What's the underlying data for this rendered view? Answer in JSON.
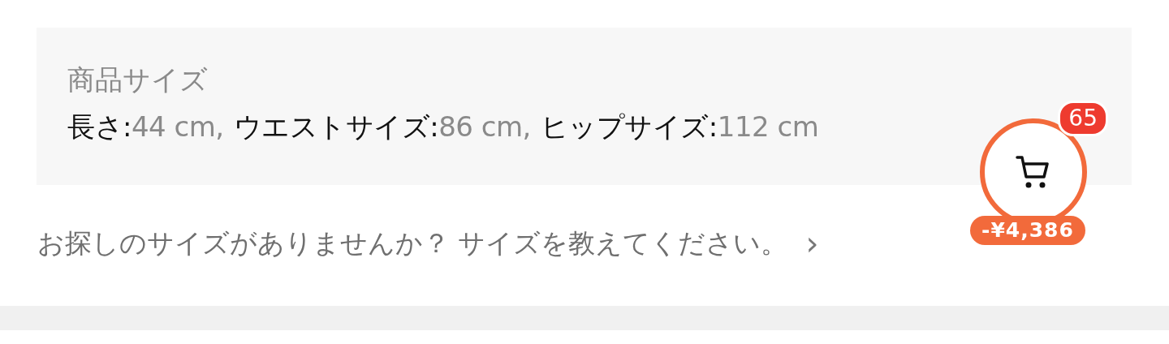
{
  "size_panel": {
    "title": "商品サイズ",
    "measurements": [
      {
        "label": "長さ:",
        "value": "44 cm,"
      },
      {
        "label": "ウエストサイズ:",
        "value": "86 cm,"
      },
      {
        "label": "ヒップサイズ:",
        "value": "112 cm"
      }
    ]
  },
  "size_request_link": {
    "text": "お探しのサイズがありませんか？ サイズを教えてください。",
    "chevron": "›"
  },
  "cart": {
    "count": "65",
    "discount": "-¥4,386"
  }
}
